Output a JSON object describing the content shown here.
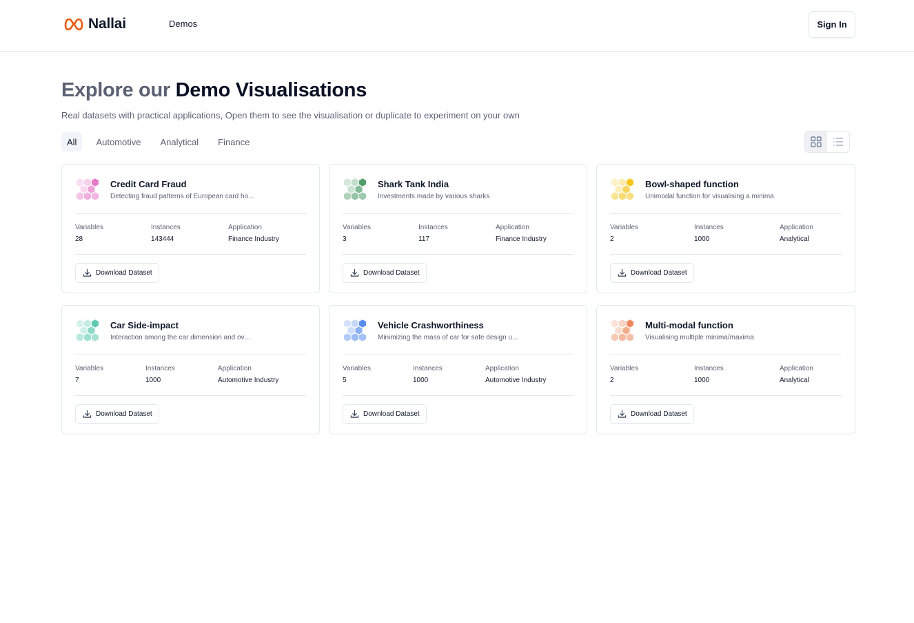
{
  "header": {
    "brand": "Nallai",
    "nav_demos": "Demos",
    "sign_in": "Sign In",
    "brand_color": "#ea580c"
  },
  "hero": {
    "title_muted": "Explore our",
    "title_strong": "Demo Visualisations",
    "subtitle": "Real datasets with practical applications, Open them to see the visualisation or duplicate to experiment on your own"
  },
  "tabs": [
    {
      "label": "All",
      "active": true
    },
    {
      "label": "Automotive",
      "active": false
    },
    {
      "label": "Analytical",
      "active": false
    },
    {
      "label": "Finance",
      "active": false
    }
  ],
  "view_toggle": {
    "active": "grid",
    "icons": [
      "grid-view-icon",
      "list-view-icon"
    ]
  },
  "cards": [
    {
      "title": "Credit Card Fraud",
      "description": "Detecting fraud patterns of European card ho...",
      "icon_color": "#e879c9",
      "stats": {
        "variables_label": "Variables",
        "variables": "28",
        "instances_label": "Instances",
        "instances": "143444",
        "application_label": "Application",
        "application": "Finance Industry"
      },
      "download_label": "Download Dataset"
    },
    {
      "title": "Shark Tank India",
      "description": "Investments made by various sharks",
      "icon_color": "#4f9e6b",
      "stats": {
        "variables_label": "Variables",
        "variables": "3",
        "instances_label": "Instances",
        "instances": "117",
        "application_label": "Application",
        "application": "Finance Industry"
      },
      "download_label": "Download Dataset"
    },
    {
      "title": "Bowl-shaped function",
      "description": "Unimodal function for visualising a minima",
      "icon_color": "#f5c518",
      "stats": {
        "variables_label": "Variables",
        "variables": "2",
        "instances_label": "Instances",
        "instances": "1000",
        "application_label": "Application",
        "application": "Analytical"
      },
      "download_label": "Download Dataset"
    },
    {
      "title": "Car Side-impact",
      "description": "Interaction among the car dimension and over...",
      "icon_color": "#5ec9b0",
      "stats": {
        "variables_label": "Variables",
        "variables": "7",
        "instances_label": "Instances",
        "instances": "1000",
        "application_label": "Application",
        "application": "Automotive Industry"
      },
      "download_label": "Download Dataset"
    },
    {
      "title": "Vehicle Crashworthiness",
      "description": "Minimizing the mass of car for safe design u...",
      "icon_color": "#5b8def",
      "stats": {
        "variables_label": "Variables",
        "variables": "5",
        "instances_label": "Instances",
        "instances": "1000",
        "application_label": "Application",
        "application": "Automotive Industry"
      },
      "download_label": "Download Dataset"
    },
    {
      "title": "Multi-modal function",
      "description": "Visualising multiple minima/maxima",
      "icon_color": "#ec8a5e",
      "stats": {
        "variables_label": "Variables",
        "variables": "2",
        "instances_label": "Instances",
        "instances": "1000",
        "application_label": "Application",
        "application": "Analytical"
      },
      "download_label": "Download Dataset"
    }
  ]
}
